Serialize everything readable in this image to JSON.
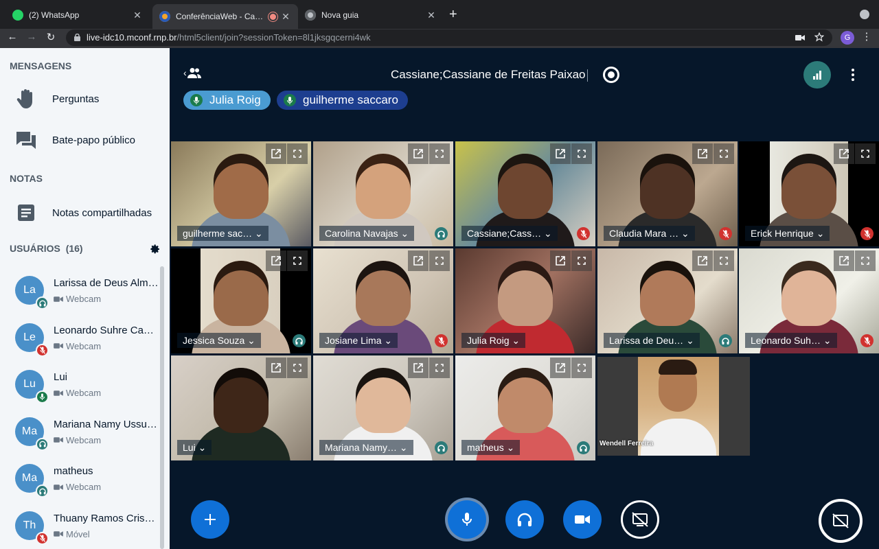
{
  "browser": {
    "tabs": [
      {
        "title": "(2) WhatsApp",
        "active": false
      },
      {
        "title": "ConferênciaWeb - Cassiane",
        "active": true
      },
      {
        "title": "Nova guia",
        "active": false
      }
    ],
    "url_domain": "live-idc10.mconf.rnp.br",
    "url_path": "/html5client/join?sessionToken=8l1jksgqcerni4wk",
    "profile_initial": "G"
  },
  "sidebar": {
    "messages_title": "MENSAGENS",
    "questions_label": "Perguntas",
    "public_chat_label": "Bate-papo público",
    "notes_title": "NOTAS",
    "shared_notes_label": "Notas compartilhadas",
    "users_title": "USUÁRIOS",
    "users_count": "(16)",
    "users": [
      {
        "initials": "La",
        "name": "Larissa de Deus Alm…",
        "status": "Webcam",
        "badge": "listen"
      },
      {
        "initials": "Le",
        "name": "Leonardo Suhre Ca…",
        "status": "Webcam",
        "badge": "muted"
      },
      {
        "initials": "Lu",
        "name": "Lui",
        "status": "Webcam",
        "badge": "mic"
      },
      {
        "initials": "Ma",
        "name": "Mariana Namy Ussu…",
        "status": "Webcam",
        "badge": "listen"
      },
      {
        "initials": "Ma",
        "name": "matheus",
        "status": "Webcam",
        "badge": "listen"
      },
      {
        "initials": "Th",
        "name": "Thuany Ramos Cris…",
        "status": "Móvel",
        "badge": "muted"
      }
    ]
  },
  "main": {
    "meeting_title": "Cassiane;Cassiane de Freitas Paixao",
    "talkers": [
      {
        "name": "Julia Roig",
        "color": "#4a9bd1"
      },
      {
        "name": "guilherme saccaro",
        "color": "#1d3e8f"
      }
    ],
    "videos": [
      {
        "name": "guilherme sac…",
        "badge": "none"
      },
      {
        "name": "Carolina Navajas",
        "badge": "listen"
      },
      {
        "name": "Cassiane;Cass…",
        "badge": "muted"
      },
      {
        "name": "Claudia Mara …",
        "badge": "muted"
      },
      {
        "name": "Erick Henrique",
        "badge": "muted"
      },
      {
        "name": "Jessica Souza",
        "badge": "listen"
      },
      {
        "name": "Josiane Lima",
        "badge": "muted"
      },
      {
        "name": "Julia Roig",
        "badge": "none"
      },
      {
        "name": "Larissa de Deu…",
        "badge": "listen"
      },
      {
        "name": "Leonardo Suh…",
        "badge": "muted"
      },
      {
        "name": "Lui",
        "badge": "none"
      },
      {
        "name": "Mariana Namy…",
        "badge": "listen"
      },
      {
        "name": "matheus",
        "badge": "listen"
      }
    ],
    "self_video_name": "Wendell Ferreira"
  },
  "colors": {
    "accent": "#0f70d7",
    "muted_badge": "#d1322f",
    "listen_badge": "#2c7b79",
    "mic_badge": "#1b7b4b",
    "sidebar_bg": "#f3f6f9",
    "main_bg": "#06172a"
  },
  "icons": {
    "questions": "raised-hand-icon",
    "public_chat": "chat-bubbles-icon",
    "shared_notes": "note-icon",
    "settings": "gear-icon",
    "webcam": "webcam-icon",
    "mic": "microphone-icon",
    "headphones": "headphones-icon",
    "camera": "video-camera-icon",
    "share": "screen-share-off-icon"
  }
}
